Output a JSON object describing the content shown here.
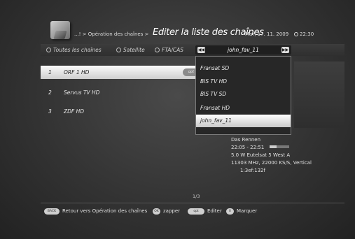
{
  "header": {
    "breadcrumb": "...! > Opération des chaînes >",
    "title": "Editer la liste des chaînes",
    "date": "Mar, 17. 11. 2009",
    "time": "22:30"
  },
  "filters": [
    {
      "label": "Toutes les chaînes"
    },
    {
      "label": "Satellite"
    },
    {
      "label": "FTA/CAS"
    }
  ],
  "favorite_selector": {
    "current": "john_fav_11",
    "left_arrow": "◀◀",
    "right_arrow": "▶▶"
  },
  "channels": [
    {
      "number": "1",
      "name": "ORF 1 HD",
      "badge": "opt"
    },
    {
      "number": "2",
      "name": "Servus TV HD"
    },
    {
      "number": "3",
      "name": "ZDF HD"
    }
  ],
  "dropdown": {
    "items": [
      "Fransat SD",
      "BIS TV HD",
      "BIS TV SD",
      "Fransat HD",
      "john_fav_11"
    ],
    "selected_index": 4
  },
  "program": {
    "title": "Das Rennen",
    "time_range": "22:05 - 22:51",
    "progress": 0.35,
    "satellite": "5.0 W Eutelsat 5 West A",
    "frequency": "11303 MHz, 22000 KS/S, Vertical",
    "service_id": "1:3ef:132f"
  },
  "page_indicator": "1/3",
  "footer": {
    "back_key": "BACK",
    "back_label": "Retour vers Opération des chaînes",
    "ok_key": "OK",
    "ok_label": "zapper",
    "opt_key": "opt",
    "opt_label": "Editer",
    "mark_key": "II",
    "mark_label": "Marquer"
  }
}
